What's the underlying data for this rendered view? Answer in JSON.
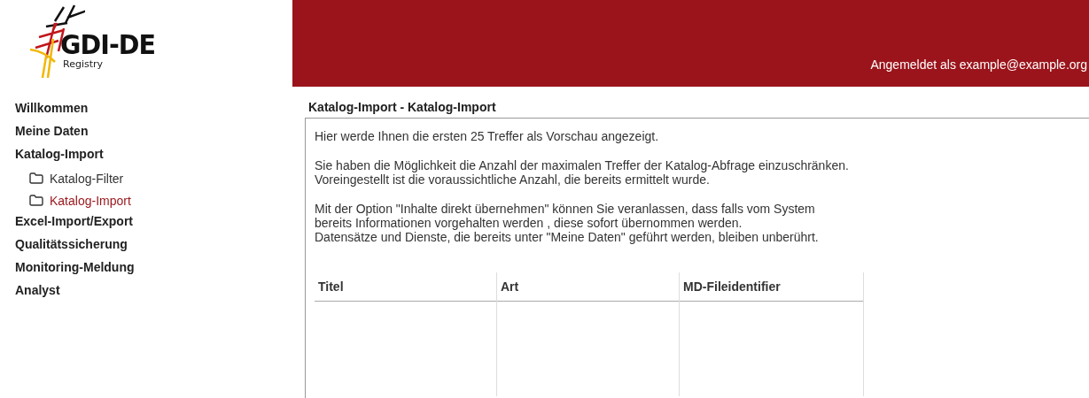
{
  "logo": {
    "title": "GDI-DE",
    "subtitle": "Registry"
  },
  "header": {
    "user_text": "Angemeldet als example@example.org"
  },
  "sidebar": {
    "items": [
      {
        "label": "Willkommen",
        "selected": false
      },
      {
        "label": "Meine Daten",
        "selected": false
      },
      {
        "label": "Katalog-Import",
        "selected": false,
        "children": [
          {
            "label": "Katalog-Filter",
            "selected": false
          },
          {
            "label": "Katalog-Import",
            "selected": true
          }
        ]
      },
      {
        "label": "Excel-Import/Export",
        "selected": false
      },
      {
        "label": "Qualitätssicherung",
        "selected": false
      },
      {
        "label": "Monitoring-Meldung",
        "selected": false
      },
      {
        "label": "Analyst",
        "selected": false
      }
    ]
  },
  "content": {
    "title": "Katalog-Import - Katalog-Import",
    "paragraphs": [
      [
        "Hier werde Ihnen die ersten 25 Treffer als Vorschau angezeigt."
      ],
      [
        "Sie haben die Möglichkeit die Anzahl der maximalen Treffer der Katalog-Abfrage einzuschränken.",
        "Voreingestellt ist die voraussichtliche Anzahl, die bereits ermittelt wurde."
      ],
      [
        "Mit der Option \"Inhalte direkt übernehmen\" können Sie veranlassen, dass falls vom System",
        "bereits Informationen vorgehalten werden , diese sofort übernommen werden.",
        "Datensätze und Dienste, die bereits unter \"Meine Daten\" geführt werden, bleiben unberührt."
      ]
    ],
    "table": {
      "columns": [
        "Titel",
        "Art",
        "MD-Fileidentifier"
      ]
    }
  }
}
